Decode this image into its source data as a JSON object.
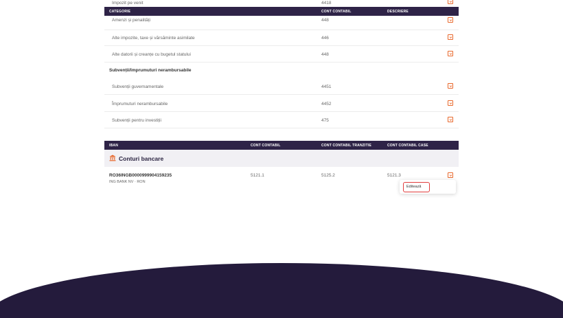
{
  "top_row": {
    "category": "Impozit pe venit",
    "account": "4418"
  },
  "table_header": {
    "col_category": "CATEGORIE",
    "col_account": "CONT CONTABIL",
    "col_description": "DESCRIERE"
  },
  "rows_a": [
    {
      "category": "Amenzi și penalități",
      "account": "448"
    },
    {
      "category": "Alte impozite, taxe și vărsăminte asimilate",
      "account": "446"
    },
    {
      "category": "Alte datorii și creanțe cu bugetul statului",
      "account": "448"
    }
  ],
  "subsection": {
    "title": "Subvenții/împrumuturi nerambursabile"
  },
  "rows_b": [
    {
      "category": "Subvenții guvernamentale",
      "account": "4451"
    },
    {
      "category": "Împrumuturi nerambursabile",
      "account": "4452"
    },
    {
      "category": "Subvenții pentru investiții",
      "account": "475"
    }
  ],
  "bank_header": {
    "col_iban": "IBAN",
    "col_account": "CONT CONTABIL",
    "col_transit": "CONT CONTABIL TRANZITIE",
    "col_cash": "CONT CONTABIL CASE"
  },
  "bank_section": {
    "title": "Conturi bancare",
    "icon": "bank-icon"
  },
  "bank_row": {
    "iban": "RO36INGB0000999904159235",
    "bank": "ING BANK NV · RON",
    "account": "5121.1",
    "transit": "5125.2",
    "cash": "5121.3"
  },
  "dropdown_menu": {
    "edit_label": "Editează"
  },
  "colors": {
    "header_bg": "#2e2347",
    "accent": "#e8672a",
    "highlight": "#e03a3a",
    "footer": "#241b3c"
  }
}
